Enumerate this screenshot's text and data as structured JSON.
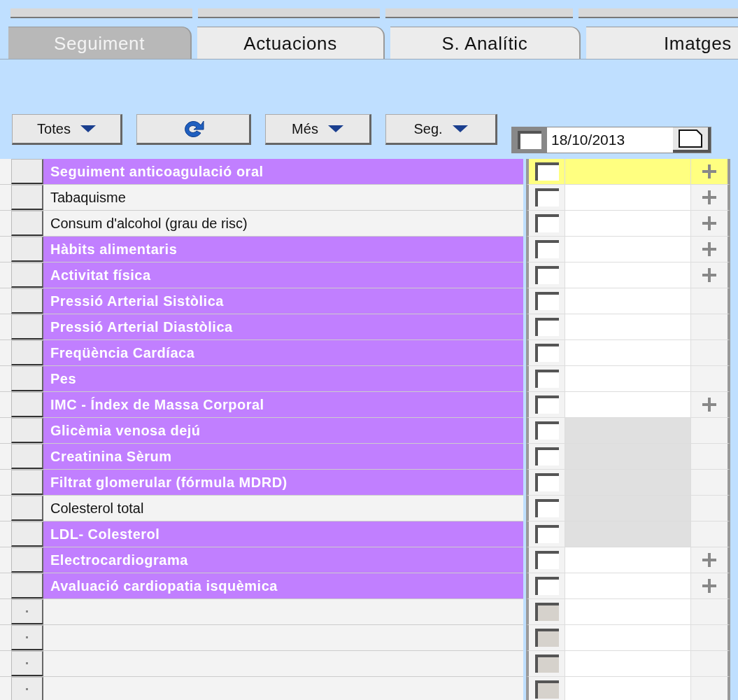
{
  "tabs": [
    {
      "label": "Seguiment",
      "selected": true
    },
    {
      "label": "Actuacions",
      "selected": false
    },
    {
      "label": "S. Analític",
      "selected": false
    },
    {
      "label": "Imatges",
      "selected": false
    }
  ],
  "toolbar": [
    {
      "kind": "dropdown",
      "label": "Totes"
    },
    {
      "kind": "refresh"
    },
    {
      "kind": "dropdown",
      "label": "Més"
    },
    {
      "kind": "dropdown",
      "label": "Seg."
    }
  ],
  "date_header": {
    "date": "18/10/2013",
    "checked": false
  },
  "rows": [
    {
      "kind": "item",
      "label": "Seguiment anticoagulació oral",
      "highlighted": true,
      "selected": true,
      "disabled": false,
      "plus": true,
      "checked": false
    },
    {
      "kind": "item",
      "label": "Tabaquisme",
      "highlighted": false,
      "selected": false,
      "disabled": false,
      "plus": true,
      "checked": false
    },
    {
      "kind": "item",
      "label": "Consum d'alcohol (grau de risc)",
      "highlighted": false,
      "selected": false,
      "disabled": false,
      "plus": true,
      "checked": false
    },
    {
      "kind": "item",
      "label": "Hàbits alimentaris",
      "highlighted": true,
      "selected": false,
      "disabled": false,
      "plus": true,
      "checked": false
    },
    {
      "kind": "item",
      "label": "Activitat física",
      "highlighted": true,
      "selected": false,
      "disabled": false,
      "plus": true,
      "checked": false
    },
    {
      "kind": "item",
      "label": "Pressió Arterial Sistòlica",
      "highlighted": true,
      "selected": false,
      "disabled": false,
      "plus": false,
      "checked": false
    },
    {
      "kind": "item",
      "label": "Pressió Arterial Diastòlica",
      "highlighted": true,
      "selected": false,
      "disabled": false,
      "plus": false,
      "checked": false
    },
    {
      "kind": "item",
      "label": "Freqüència Cardíaca",
      "highlighted": true,
      "selected": false,
      "disabled": false,
      "plus": false,
      "checked": false
    },
    {
      "kind": "item",
      "label": "Pes",
      "highlighted": true,
      "selected": false,
      "disabled": false,
      "plus": false,
      "checked": false
    },
    {
      "kind": "item",
      "label": "IMC - Índex de Massa Corporal",
      "highlighted": true,
      "selected": false,
      "disabled": false,
      "plus": true,
      "checked": false
    },
    {
      "kind": "item",
      "label": "Glicèmia venosa dejú",
      "highlighted": true,
      "selected": false,
      "disabled": true,
      "plus": false,
      "checked": false
    },
    {
      "kind": "item",
      "label": "Creatinina Sèrum",
      "highlighted": true,
      "selected": false,
      "disabled": true,
      "plus": false,
      "checked": false
    },
    {
      "kind": "item",
      "label": "Filtrat glomerular (fórmula MDRD)",
      "highlighted": true,
      "selected": false,
      "disabled": true,
      "plus": false,
      "checked": false
    },
    {
      "kind": "item",
      "label": "Colesterol total",
      "highlighted": false,
      "selected": false,
      "disabled": true,
      "plus": false,
      "checked": false
    },
    {
      "kind": "item",
      "label": "LDL- Colesterol",
      "highlighted": true,
      "selected": false,
      "disabled": true,
      "plus": false,
      "checked": false
    },
    {
      "kind": "item",
      "label": "Electrocardiograma",
      "highlighted": true,
      "selected": false,
      "disabled": false,
      "plus": true,
      "checked": false
    },
    {
      "kind": "item",
      "label": "Avaluació cardiopatia isquèmica",
      "highlighted": true,
      "selected": false,
      "disabled": false,
      "plus": true,
      "checked": false
    },
    {
      "kind": "empty",
      "checked": false,
      "disabled": true
    },
    {
      "kind": "empty",
      "checked": false,
      "disabled": true
    },
    {
      "kind": "empty",
      "checked": false,
      "disabled": true
    },
    {
      "kind": "empty",
      "checked": false,
      "disabled": true
    }
  ]
}
